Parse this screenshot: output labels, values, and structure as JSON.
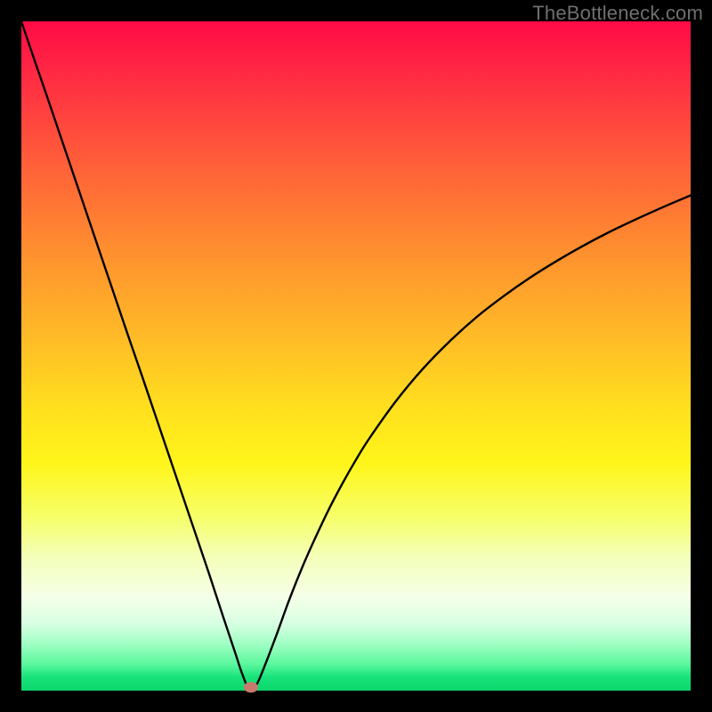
{
  "watermark": "TheBottleneck.com",
  "chart_data": {
    "type": "line",
    "title": "",
    "xlabel": "",
    "ylabel": "",
    "xlim": [
      0,
      100
    ],
    "ylim": [
      0,
      100
    ],
    "grid": false,
    "legend": false,
    "series": [
      {
        "name": "bottleneck-curve",
        "x": [
          0,
          2,
          4,
          6,
          8,
          10,
          12,
          14,
          16,
          18,
          20,
          22,
          24,
          26,
          28,
          30,
          32,
          33,
          34,
          35,
          36,
          38,
          40,
          42,
          44,
          46,
          48,
          50,
          52,
          56,
          60,
          64,
          68,
          72,
          76,
          80,
          84,
          88,
          92,
          96,
          100
        ],
        "y": [
          100,
          94.1,
          88.3,
          82.4,
          76.5,
          70.6,
          64.7,
          58.8,
          52.9,
          47.1,
          41.2,
          35.3,
          29.4,
          23.5,
          17.6,
          11.5,
          5.5,
          2.5,
          0.3,
          0.7,
          2.8,
          8.0,
          13.5,
          18.5,
          23.0,
          27.2,
          31.0,
          34.5,
          37.7,
          43.3,
          48.1,
          52.2,
          55.8,
          58.9,
          61.7,
          64.2,
          66.5,
          68.6,
          70.5,
          72.3,
          74.0
        ]
      }
    ],
    "marker": {
      "x": 34.3,
      "y": 0.5,
      "color": "#c97a6f"
    },
    "gradient_stops": [
      {
        "pos": 0.0,
        "color": "#ff0b46"
      },
      {
        "pos": 0.5,
        "color": "#ffd324"
      },
      {
        "pos": 0.8,
        "color": "#f5ffcf"
      },
      {
        "pos": 1.0,
        "color": "#0cd66c"
      }
    ]
  }
}
